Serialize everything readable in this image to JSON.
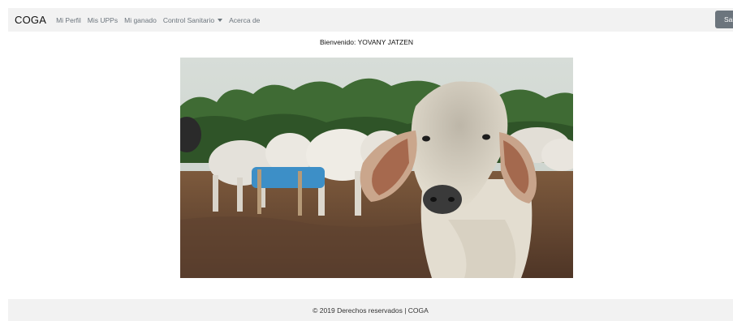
{
  "navbar": {
    "brand": "COGA",
    "items": [
      {
        "label": "Mi Perfil"
      },
      {
        "label": "Mis UPPs"
      },
      {
        "label": "Mi ganado"
      },
      {
        "label": "Control Sanitario"
      },
      {
        "label": "Acerca de"
      }
    ],
    "logout_label": "Salir"
  },
  "welcome_text": "Bienvenido: YOVANY JATZEN",
  "footer_text": "© 2019 Derechos reservados | COGA"
}
